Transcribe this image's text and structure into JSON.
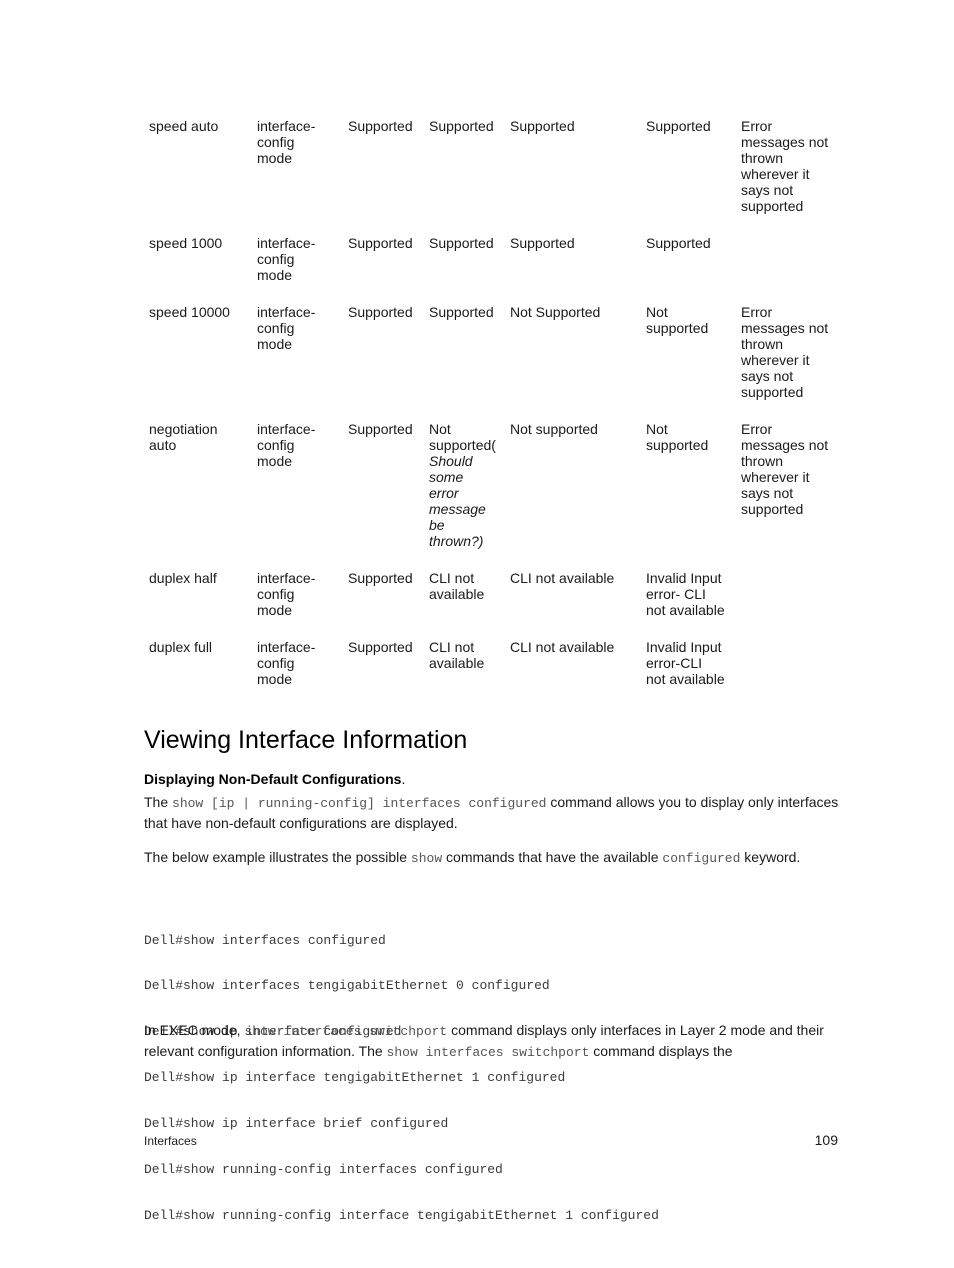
{
  "table": {
    "rows": [
      {
        "command": "speed auto",
        "mode": "interface-\nconfig\nmode",
        "col3": "Supported",
        "col4": "Supported",
        "col5": "Supported",
        "col6": "Supported",
        "remarks": "Error\nmessages not\nthrown\nwherever it\nsays not\nsupported"
      },
      {
        "command": "speed 1000",
        "mode": "interface-\nconfig\nmode",
        "col3": "Supported",
        "col4": "Supported",
        "col5": "Supported",
        "col6": "Supported",
        "remarks": ""
      },
      {
        "command": "speed 10000",
        "mode": "interface-\nconfig\nmode",
        "col3": "Supported",
        "col4": "Supported",
        "col5": "Not Supported",
        "col6": "Not\nsupported",
        "remarks": "Error\nmessages not\nthrown\nwherever it\nsays not\nsupported"
      },
      {
        "command": "negotiation\nauto",
        "mode": "interface-\nconfig\nmode",
        "col3": "Supported",
        "col4": "Not\nsupported(",
        "col4_italic": "Should\nsome\nerror\nmessage\nbe\nthrown?)",
        "col5": "Not supported",
        "col6": "Not\nsupported",
        "remarks": "Error\nmessages not\nthrown\nwherever it\nsays not\nsupported"
      },
      {
        "command": "duplex half",
        "mode": "interface-\nconfig\nmode",
        "col3": "Supported",
        "col4": "CLI not\navailable",
        "col5": "CLI not available",
        "col6": "Invalid Input\nerror- CLI\nnot available",
        "remarks": ""
      },
      {
        "command": "duplex full",
        "mode": "interface-\nconfig\nmode",
        "col3": "Supported",
        "col4": "CLI not\navailable",
        "col5": "CLI not available",
        "col6": "Invalid Input\nerror-CLI\nnot available",
        "remarks": ""
      }
    ]
  },
  "section": {
    "title": "Viewing Interface Information",
    "subheading": "Displaying Non-Default Configurations",
    "subheading_suffix": ".",
    "para1": {
      "pre": "The ",
      "code": "show [ip | running-config] interfaces configured",
      "post": " command allows you to display only interfaces that have non-default configurations are displayed."
    },
    "para2": {
      "pre": "The below example illustrates the possible ",
      "code1": "show",
      "mid": " commands that have the available ",
      "code2": "configured",
      "post": " keyword."
    },
    "code_lines": [
      "Dell#show interfaces configured",
      "Dell#show interfaces tengigabitEthernet 0 configured",
      "Dell#show ip interface configured",
      "Dell#show ip interface tengigabitEthernet 1 configured",
      "Dell#show ip interface brief configured",
      "Dell#show running-config interfaces configured",
      "Dell#show running-config interface tengigabitEthernet 1 configured"
    ],
    "para3": {
      "pre": "In EXEC mode, ",
      "code1": "show interfaces switchport",
      "mid": " command displays only interfaces in Layer 2 mode and their relevant configuration information. The ",
      "code2": "show interfaces switchport",
      "post": " command displays the"
    }
  },
  "footer": {
    "section_name": "Interfaces",
    "page_number": "109"
  }
}
